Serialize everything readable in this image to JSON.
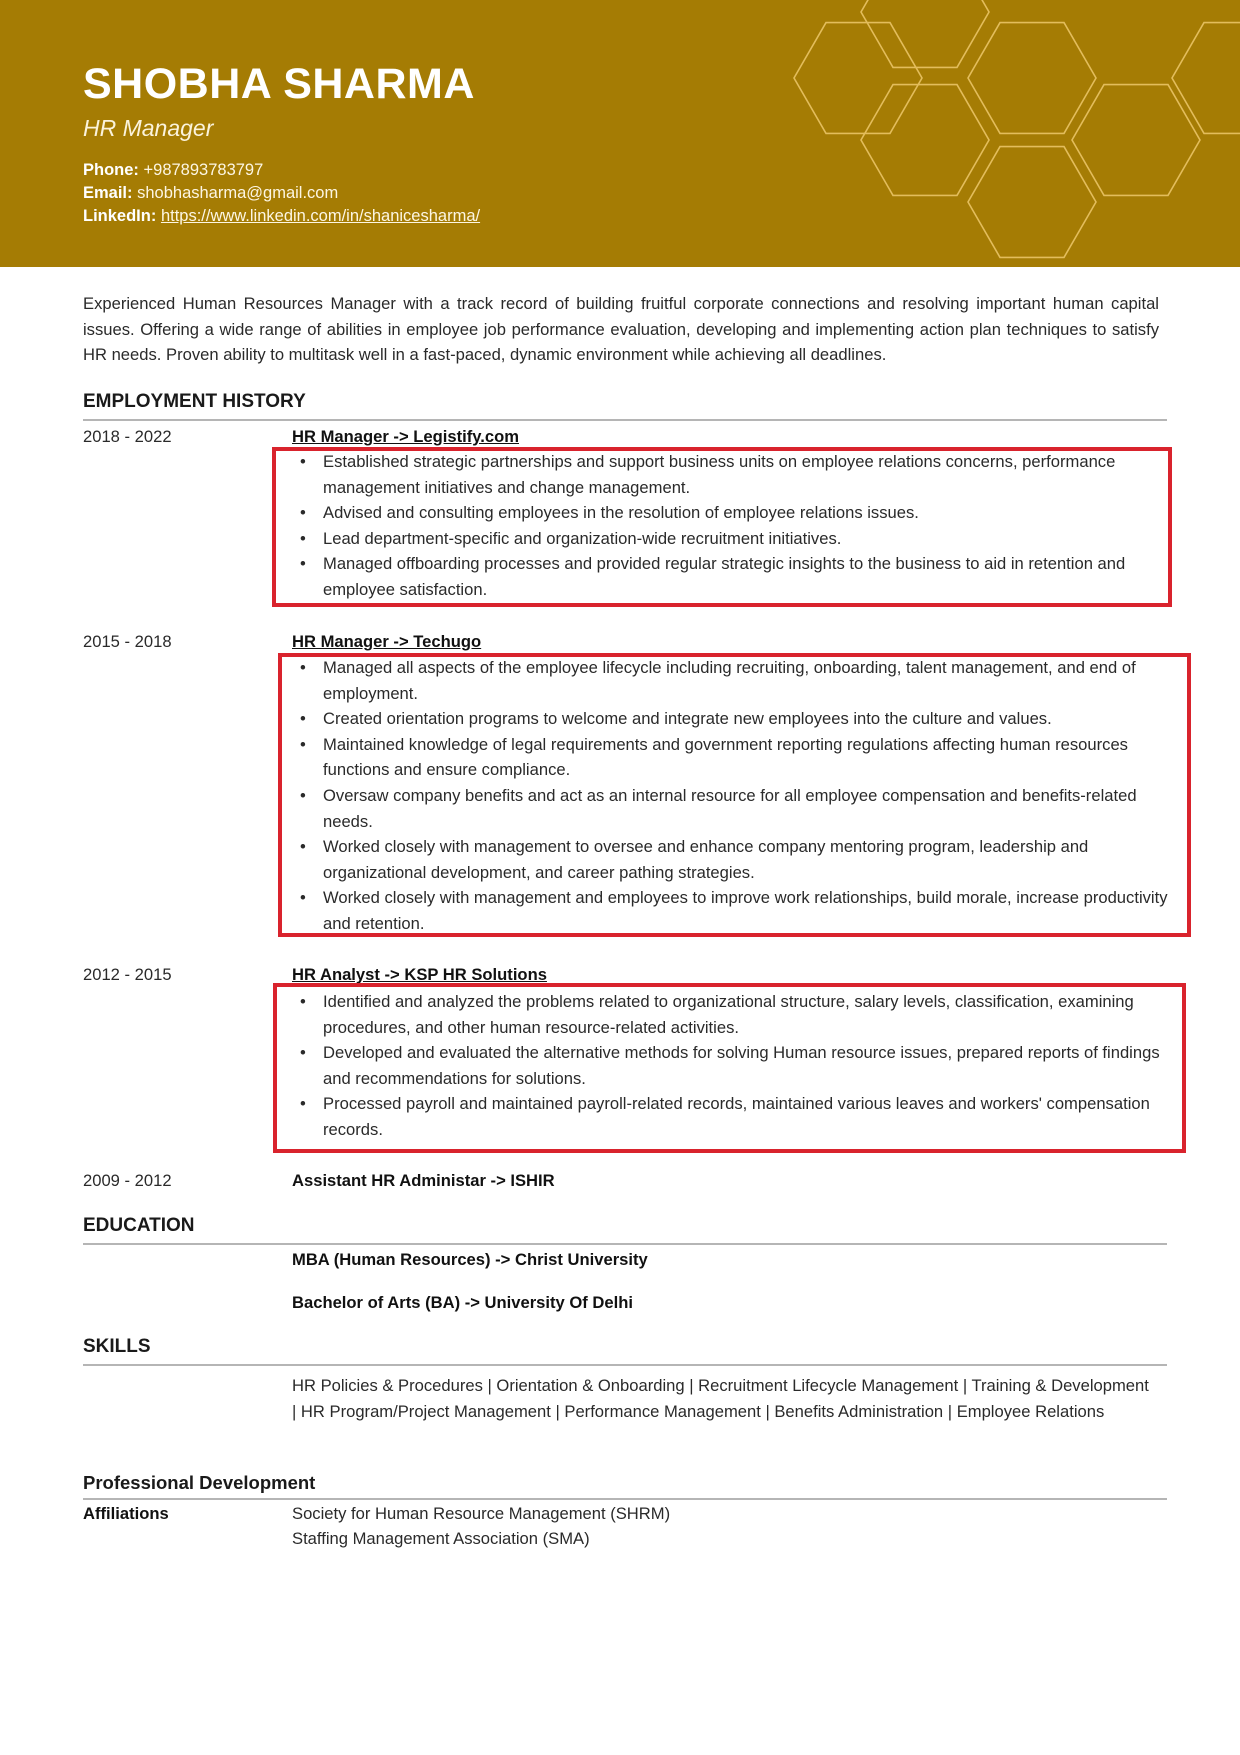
{
  "header": {
    "name": "SHOBHA SHARMA",
    "role": "HR Manager",
    "phone_label": "Phone:",
    "phone": "+987893783797",
    "email_label": "Email:",
    "email": "shobhasharma@gmail.com",
    "linkedin_label": "LinkedIn:",
    "linkedin": "https://www.linkedin.com/in/shanicesharma/",
    "background_color": "#a57c04",
    "hexagon_color": "#e3bd5c"
  },
  "summary": "Experienced Human Resources Manager with a track record of building fruitful corporate connections and resolving important human capital issues. Offering a wide range of abilities in employee job performance evaluation, developing and implementing action plan techniques to satisfy HR needs. Proven ability to multitask well in a fast-paced, dynamic environment while achieving all deadlines.",
  "employment": {
    "title": "EMPLOYMENT HISTORY",
    "jobs": [
      {
        "dates": "2018 - 2022",
        "title": "HR Manager  -> Legistify.com",
        "bullets": [
          "Established strategic partnerships and support business units on employee relations concerns, performance management initiatives and change management.",
          "Advised and consulting employees in the resolution of employee relations issues.",
          "Lead department-specific and organization-wide recruitment initiatives.",
          "Managed offboarding processes and provided regular strategic insights to the business to aid in retention and employee satisfaction."
        ]
      },
      {
        "dates": "2015 - 2018",
        "title": "HR Manager  -> Techugo",
        "bullets": [
          "Managed all aspects of the employee lifecycle including recruiting, onboarding, talent management, and end of employment.",
          "Created orientation programs to welcome and integrate new employees into the culture and values.",
          "Maintained knowledge of legal requirements and government reporting regulations affecting human resources functions and ensure compliance.",
          "Oversaw company benefits and act as an internal resource for all employee compensation and benefits-related needs.",
          "Worked closely with management to oversee and enhance company mentoring program, leadership and organizational development, and career pathing strategies.",
          "Worked closely with management and employees to improve work relationships, build morale, increase productivity and retention."
        ]
      },
      {
        "dates": "2012 - 2015",
        "title": "HR Analyst  -> KSP HR Solutions",
        "bullets": [
          "Identified and analyzed the problems related to organizational structure, salary levels, classification, examining procedures, and other human resource-related activities.",
          "Developed and evaluated the alternative methods for solving Human resource issues, prepared reports of findings and recommendations for solutions.",
          "Processed payroll and maintained payroll-related records, maintained various leaves and workers' compensation records."
        ]
      },
      {
        "dates": "2009 - 2012",
        "title": "Assistant HR Administar  -> ISHIR",
        "bullets": []
      }
    ]
  },
  "education": {
    "title": "EDUCATION",
    "items": [
      "MBA (Human Resources)  -> Christ University",
      "Bachelor of Arts (BA)  -> University Of Delhi"
    ]
  },
  "skills": {
    "title": "SKILLS",
    "text": "HR Policies & Procedures | Orientation & Onboarding | Recruitment Lifecycle Management | Training & Development | HR Program/Project Management | Performance Management | Benefits Administration | Employee Relations"
  },
  "professional_development": {
    "title": "Professional Development",
    "affiliations_label": "Affiliations",
    "affiliations": [
      "Society for Human Resource Management (SHRM)",
      "Staffing Management Association (SMA)"
    ]
  },
  "annotation": {
    "highlight_color": "#d9232d"
  },
  "bullet_glyph": "•"
}
